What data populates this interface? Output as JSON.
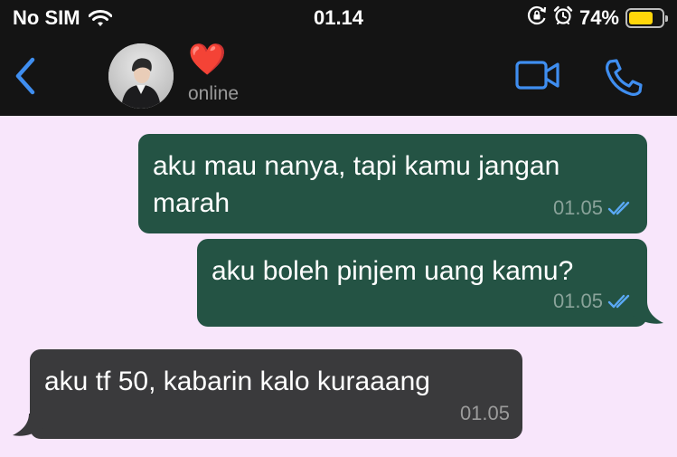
{
  "status_bar": {
    "carrier": "No SIM",
    "time": "01.14",
    "battery_percent": "74%",
    "battery_level": 0.74,
    "icons": [
      "wifi-icon",
      "rotation-lock-icon",
      "alarm-icon",
      "battery-icon"
    ]
  },
  "header": {
    "contact_name": "❤️",
    "status": "online",
    "icons": [
      "back-chevron-icon",
      "video-camera-icon",
      "phone-icon"
    ]
  },
  "messages": [
    {
      "direction": "outgoing",
      "lines": [
        "aku mau nanya, tapi kamu jangan",
        "marah"
      ],
      "time": "01.05",
      "read": true
    },
    {
      "direction": "outgoing",
      "lines": [
        "aku boleh pinjem uang kamu?"
      ],
      "time": "01.05",
      "read": true
    },
    {
      "direction": "incoming",
      "lines": [
        "aku tf 50, kabarin kalo kuraaang"
      ],
      "time": "01.05",
      "read": false
    }
  ],
  "colors": {
    "chat_background": "#f8e6fb",
    "bar_background": "#141414",
    "outgoing_bubble": "#245344",
    "incoming_bubble": "#3a3a3c",
    "accent_blue": "#3f8ef0",
    "read_ticks": "#5aa9f5"
  }
}
